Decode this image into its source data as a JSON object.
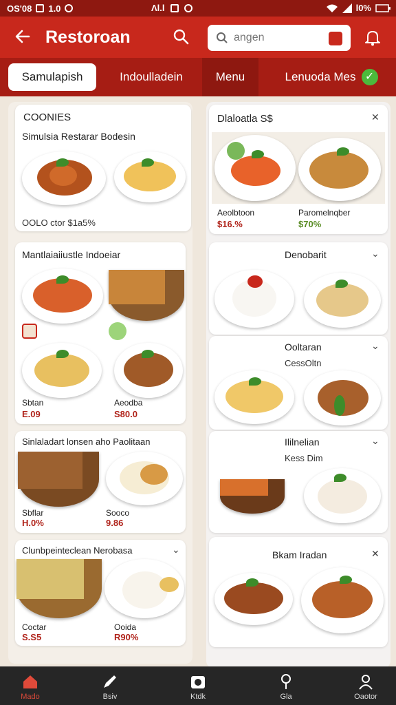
{
  "status_bar": {
    "time": "OS'08",
    "indicator": "1.0",
    "signal": "Λl.l",
    "battery": "l0%"
  },
  "app_bar": {
    "title": "Restoroan",
    "search_placeholder": "angen"
  },
  "tabs": [
    {
      "label": "Samulapish",
      "active": true
    },
    {
      "label": "Indoulladein",
      "active": false
    },
    {
      "label": "Menu",
      "active": false
    },
    {
      "label": "Lenuoda Mes",
      "active": false,
      "verified": true
    }
  ],
  "left_cards": [
    {
      "header": "COONIES",
      "title": "Simulsia Restarar Bodesin",
      "price_text": "OOLO ctor $1a5%"
    },
    {
      "title": "Mantlaiaiiustle Indoeiar",
      "items": [
        {
          "name": "Sbtan",
          "price": "E.09"
        },
        {
          "name": "Aeodba",
          "price": "S80.0"
        }
      ]
    },
    {
      "title": "Sinlaladart lonsen aho Paolitaan",
      "items": [
        {
          "name": "Sbflar",
          "price": "H.0%"
        },
        {
          "name": "Sooco",
          "price": "9.86"
        }
      ]
    },
    {
      "title": "Clunbpeinteclean Nerobasa",
      "items": [
        {
          "name": "Coctar",
          "price": "S.S5"
        },
        {
          "name": "Ooida",
          "price": "R90%"
        }
      ]
    }
  ],
  "right_cards": [
    {
      "title": "Dlaloatla S$",
      "items": [
        {
          "name": "Aeolbtoon",
          "price": "$16.%"
        },
        {
          "name": "Paromelnqber",
          "price": "$70%"
        }
      ]
    },
    {
      "title": "Denobarit"
    },
    {
      "title": "Ooltaran",
      "subtitle": "CessOltn"
    },
    {
      "title": "Ililnelian",
      "subtitle": "Kess Dim"
    },
    {
      "title": "Bkam Iradan"
    }
  ],
  "bottom_nav": [
    {
      "label": "Mado",
      "active": true
    },
    {
      "label": "Bsiv",
      "active": false
    },
    {
      "label": "Ktdk",
      "active": false
    },
    {
      "label": "Gla",
      "active": false
    },
    {
      "label": "Oaotor",
      "active": false
    }
  ],
  "colors": {
    "primary": "#c8281c",
    "primary_dark": "#a61d14",
    "status": "#8e1810",
    "price": "#b0231a",
    "verified": "#4cba3c",
    "nav_bg": "#262626"
  }
}
